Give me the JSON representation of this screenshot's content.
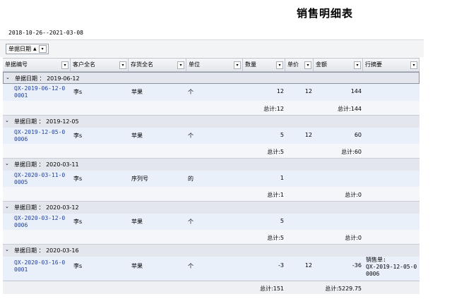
{
  "report": {
    "title": "销售明细表",
    "date_range": "2018-10-26--2021-03-08"
  },
  "groupbar": {
    "chip_label": "单据日期",
    "sort_glyph": "▲",
    "dropdown_glyph": "▾"
  },
  "columns": [
    {
      "label": "单据编号"
    },
    {
      "label": "客户全名"
    },
    {
      "label": "存货全名"
    },
    {
      "label": "单位"
    },
    {
      "label": "数量"
    },
    {
      "label": "单价"
    },
    {
      "label": "金额"
    },
    {
      "label": "行摘要"
    }
  ],
  "groups": [
    {
      "label": "单据日期 ： 2019-06-12",
      "row": {
        "doc_l1": "QX-2019-06-12-0",
        "doc_l2": "0001",
        "customer": "李s",
        "item": "苹果",
        "unit": "个",
        "qty": "12",
        "price": "12",
        "amount": "144",
        "memo_l1": "",
        "memo_l2": ""
      },
      "totals": {
        "qty": "总计:12",
        "amount": "总计:144"
      }
    },
    {
      "label": "单据日期 ： 2019-12-05",
      "row": {
        "doc_l1": "QX-2019-12-05-0",
        "doc_l2": "0006",
        "customer": "李s",
        "item": "苹果",
        "unit": "个",
        "qty": "5",
        "price": "12",
        "amount": "60",
        "memo_l1": "",
        "memo_l2": ""
      },
      "totals": {
        "qty": "总计:5",
        "amount": "总计:60"
      }
    },
    {
      "label": "单据日期 ： 2020-03-11",
      "row": {
        "doc_l1": "QX-2020-03-11-0",
        "doc_l2": "0005",
        "customer": "李s",
        "item": "序列号",
        "unit": "的",
        "qty": "1",
        "price": "",
        "amount": "",
        "memo_l1": "",
        "memo_l2": ""
      },
      "totals": {
        "qty": "总计:1",
        "amount": "总计:0"
      }
    },
    {
      "label": "单据日期 ： 2020-03-12",
      "row": {
        "doc_l1": "QX-2020-03-12-0",
        "doc_l2": "0006",
        "customer": "李s",
        "item": "苹果",
        "unit": "个",
        "qty": "5",
        "price": "",
        "amount": "",
        "memo_l1": "",
        "memo_l2": ""
      },
      "totals": {
        "qty": "总计:5",
        "amount": "总计:0"
      }
    },
    {
      "label": "单据日期 ： 2020-03-16",
      "row": {
        "doc_l1": "QX-2020-03-16-0",
        "doc_l2": "0001",
        "customer": "李s",
        "item": "苹果",
        "unit": "个",
        "qty": "-3",
        "price": "12",
        "amount": "-36",
        "memo_l1": "销售单:",
        "memo_l2": "QX-2019-12-05-0",
        "memo_l3": "0006"
      },
      "totals": {
        "qty": "",
        "amount": ""
      }
    }
  ],
  "grand_totals": {
    "qty": "总计:151",
    "amount": "总计:5229.75"
  }
}
